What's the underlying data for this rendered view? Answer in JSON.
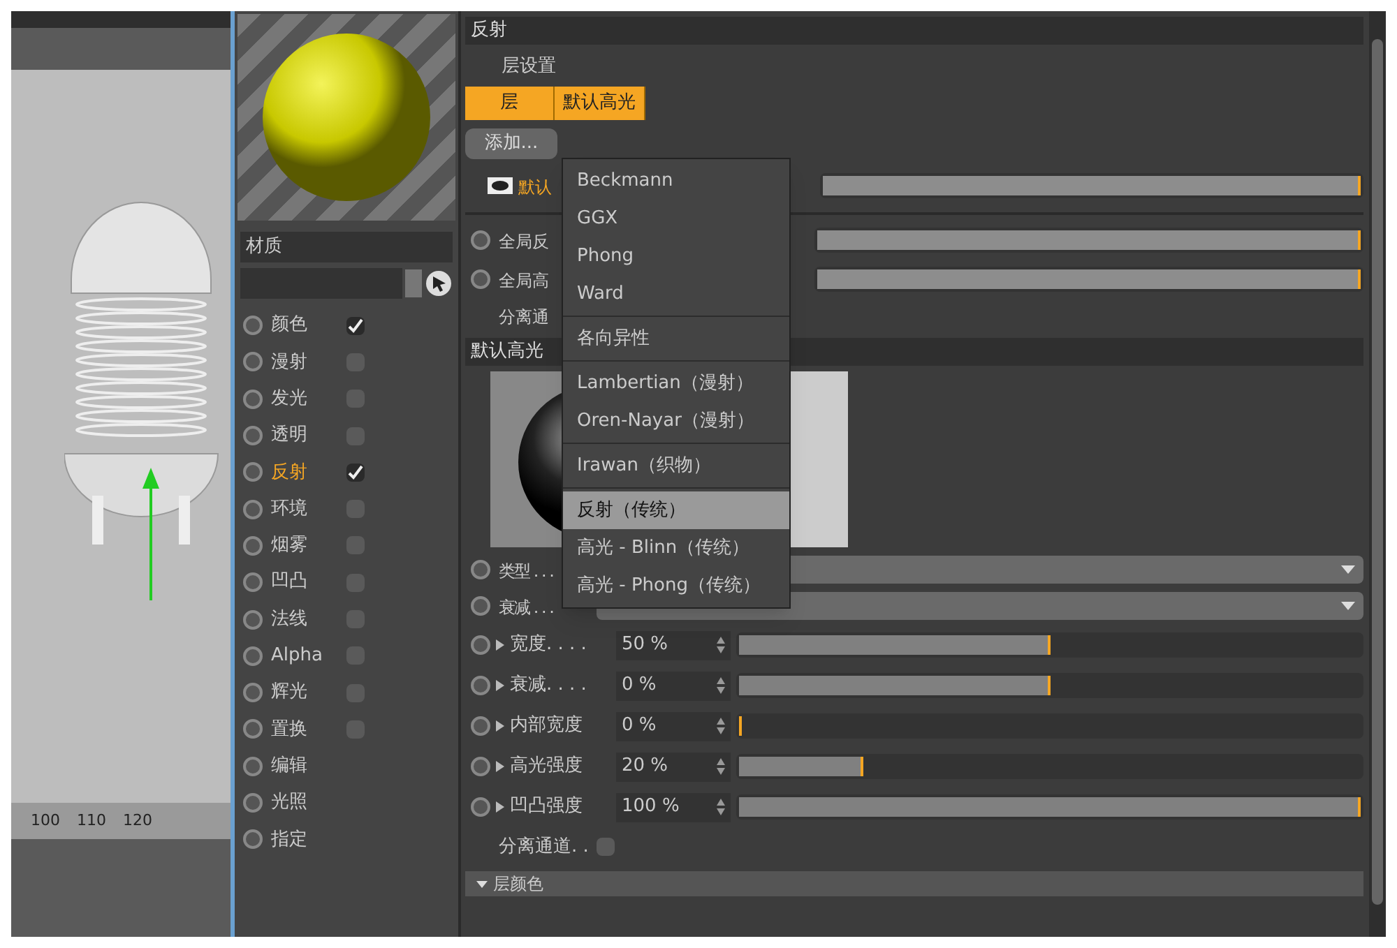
{
  "viewport": {
    "ruler": [
      "100",
      "110",
      "120"
    ]
  },
  "material": {
    "name": "材质",
    "channels": [
      {
        "label": "颜色",
        "selected": false,
        "checked": true
      },
      {
        "label": "漫射",
        "selected": false,
        "checked": false
      },
      {
        "label": "发光",
        "selected": false,
        "checked": false
      },
      {
        "label": "透明",
        "selected": false,
        "checked": false
      },
      {
        "label": "反射",
        "selected": true,
        "checked": true
      },
      {
        "label": "环境",
        "selected": false,
        "checked": false
      },
      {
        "label": "烟雾",
        "selected": false,
        "checked": false
      },
      {
        "label": "凹凸",
        "selected": false,
        "checked": false
      },
      {
        "label": "法线",
        "selected": false,
        "checked": false
      },
      {
        "label": "Alpha",
        "selected": false,
        "checked": false
      },
      {
        "label": "辉光",
        "selected": false,
        "checked": false
      },
      {
        "label": "置换",
        "selected": false,
        "checked": false
      },
      {
        "label": "编辑",
        "selected": false
      },
      {
        "label": "光照",
        "selected": false
      },
      {
        "label": "指定",
        "selected": false
      }
    ]
  },
  "attributes": {
    "title": "反射",
    "layer_settings": "层设置",
    "tabs": [
      {
        "label": "层",
        "selected": true
      },
      {
        "label": "默认高光",
        "selected": true
      }
    ],
    "add_button": "添加...",
    "layer": {
      "name": "默认",
      "level": 1
    },
    "globals": [
      {
        "label": "全局反",
        "level": 1,
        "keyed": false
      },
      {
        "label": "全局高",
        "level": 1,
        "keyed": false
      }
    ],
    "separate_label": "分离通",
    "section": "默认高光",
    "dropdowns": [
      {
        "label": "类型 . . .",
        "keyed": false
      },
      {
        "label": "衰减 . . .",
        "keyed": false
      }
    ],
    "params": [
      {
        "label": "宽度. . . .",
        "value": "50 %",
        "level": 0.5,
        "keyed": false
      },
      {
        "label": "衰减. . . .",
        "value": "0 %",
        "level": 0.5,
        "keyed": false
      },
      {
        "label": "内部宽度",
        "value": "0 %",
        "level": 0,
        "keyed": false
      },
      {
        "label": "高光强度",
        "value": "20 %",
        "level": 0.2,
        "keyed": false
      },
      {
        "label": "凹凸强度",
        "value": "100 %",
        "level": 1,
        "keyed": false
      }
    ],
    "separate_channels": {
      "label": "分离通道. .",
      "checked": false
    },
    "layer_color": "层颜色"
  },
  "menu": {
    "groups": [
      [
        {
          "label": "Beckmann",
          "selected": false
        },
        {
          "label": "GGX",
          "selected": false
        },
        {
          "label": "Phong",
          "selected": false
        },
        {
          "label": "Ward",
          "selected": false
        }
      ],
      [
        {
          "label": "各向异性",
          "selected": false
        }
      ],
      [
        {
          "label": "Lambertian（漫射）",
          "selected": false
        },
        {
          "label": "Oren-Nayar（漫射）",
          "selected": false
        }
      ],
      [
        {
          "label": "Irawan（织物）",
          "selected": false
        }
      ],
      [
        {
          "label": "反射（传统）",
          "selected": true
        },
        {
          "label": "高光 - Blinn（传统）",
          "selected": false
        },
        {
          "label": "高光 - Phong（传统）",
          "selected": false
        }
      ]
    ]
  }
}
